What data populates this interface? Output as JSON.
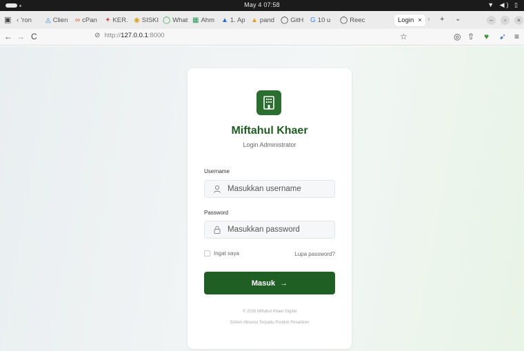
{
  "os": {
    "clock": "May 4  07:58"
  },
  "tabs": [
    {
      "icon": "‹",
      "label": "'ron"
    },
    {
      "icon": "◬",
      "label": "Clien"
    },
    {
      "icon": "∞",
      "label": "cPan"
    },
    {
      "icon": "✦",
      "label": "KER."
    },
    {
      "icon": "◉",
      "label": "SISKI"
    },
    {
      "icon": "◯",
      "label": "What"
    },
    {
      "icon": "▦",
      "label": "Ahm"
    },
    {
      "icon": "▲",
      "label": "1. Ap"
    },
    {
      "icon": "▲",
      "label": "pand"
    },
    {
      "icon": "◯",
      "label": "GitH"
    },
    {
      "icon": "G",
      "label": "10 u"
    },
    {
      "icon": "◯",
      "label": "Reec"
    }
  ],
  "active_tab": {
    "label": "Login",
    "close": "×"
  },
  "nav": {
    "back": "←",
    "forward": "→",
    "reload": "C",
    "url_scheme": "http://",
    "url_host": "127.0.0.1",
    "url_port": ":8000"
  },
  "card": {
    "title": "Miftahul Khaer",
    "subtitle": "Login Administrator",
    "username_label": "Username",
    "username_placeholder": "Masukkan username",
    "password_label": "Password",
    "password_placeholder": "Masukkan password",
    "remember_label": "Ingat saya",
    "forgot_label": "Lupa password?",
    "submit_label": "Masuk",
    "submit_arrow": "→",
    "footer_copyright": "© 2026 Miftahul Khaer Digital",
    "footer_system": "Sistem Absensi Terpadu Pondok Pesantren"
  },
  "colors": {
    "brand_green": "#1f5f23",
    "title_green": "#1e5e22"
  }
}
